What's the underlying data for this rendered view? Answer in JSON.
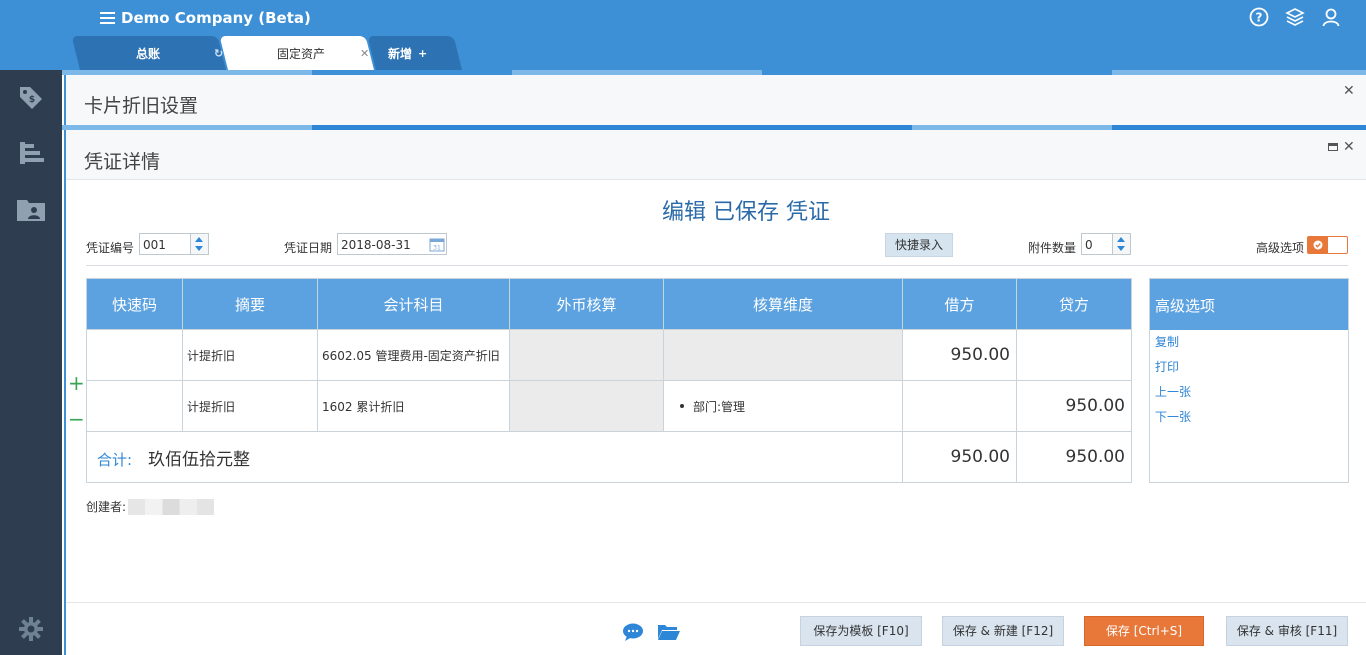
{
  "app": {
    "company": "Demo Company (Beta)"
  },
  "tabs": [
    {
      "label": "总账",
      "icon": "refresh-icon"
    },
    {
      "label": "固定资产",
      "icon": "close-icon"
    },
    {
      "label": "新增",
      "icon": "plus-icon"
    }
  ],
  "top_icons": [
    "help-icon",
    "layers-icon",
    "user-icon"
  ],
  "sidebar": [
    "tag-icon",
    "chart-bars-icon",
    "folder-user-icon",
    "gear-icon"
  ],
  "back_panel": {
    "title": "卡片折旧设置"
  },
  "panel": {
    "title": "凭证详情"
  },
  "voucher": {
    "heading": "编辑 已保存 凭证",
    "number_label": "凭证编号",
    "number_value": "001",
    "date_label": "凭证日期",
    "date_value": "2018-08-31",
    "quick_entry": "快捷录入",
    "attach_label": "附件数量",
    "attach_value": "0",
    "advanced_label": "高级选项"
  },
  "table": {
    "headers": [
      "快速码",
      "摘要",
      "会计科目",
      "外币核算",
      "核算维度",
      "借方",
      "贷方"
    ],
    "rows": [
      {
        "code": "",
        "summary": "计提折旧",
        "account": "6602.05 管理费用-固定资产折旧",
        "fx": "",
        "dimension": "",
        "debit": "950.00",
        "credit": ""
      },
      {
        "code": "",
        "summary": "计提折旧",
        "account": "1602 累计折旧",
        "fx": "",
        "dimension": "部门:管理",
        "debit": "",
        "credit": "950.00"
      }
    ],
    "total_label": "合计:",
    "total_words": "玖佰伍拾元整",
    "total_debit": "950.00",
    "total_credit": "950.00"
  },
  "advanced": {
    "title": "高级选项",
    "links": [
      "复制",
      "打印",
      "上一张",
      "下一张"
    ]
  },
  "creator_label": "创建者:",
  "footer": {
    "save_template": "保存为模板 [F10]",
    "save_new": "保存 & 新建 [F12]",
    "save": "保存 [Ctrl+S]",
    "save_audit": "保存 & 审核 [F11]"
  },
  "colors": {
    "brand": "#3d8fd6",
    "accent": "#e8773a",
    "sidebar": "#2e3e50",
    "header_cell": "#5da2e0"
  }
}
